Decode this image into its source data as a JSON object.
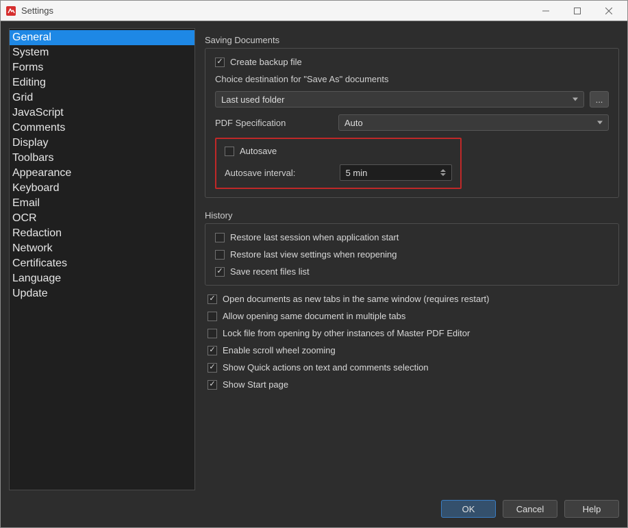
{
  "window": {
    "title": "Settings"
  },
  "sidebar": {
    "items": [
      "General",
      "System",
      "Forms",
      "Editing",
      "Grid",
      "JavaScript",
      "Comments",
      "Display",
      "Toolbars",
      "Appearance",
      "Keyboard",
      "Email",
      "OCR",
      "Redaction",
      "Network",
      "Certificates",
      "Language",
      "Update"
    ],
    "selected_index": 0
  },
  "saving": {
    "group_label": "Saving Documents",
    "create_backup": {
      "checked": true,
      "label": "Create backup file"
    },
    "save_as_dest_label": "Choice destination for \"Save As\" documents",
    "save_as_dest_value": "Last used folder",
    "browse_label": "...",
    "pdf_spec_label": "PDF Specification",
    "pdf_spec_value": "Auto",
    "autosave": {
      "checked": false,
      "label": "Autosave"
    },
    "autosave_interval_label": "Autosave interval:",
    "autosave_interval_value": "5 min"
  },
  "history": {
    "group_label": "History",
    "restore_session": {
      "checked": false,
      "label": "Restore last session when application start"
    },
    "restore_view": {
      "checked": false,
      "label": "Restore last view settings when reopening"
    },
    "save_recent": {
      "checked": true,
      "label": "Save recent files list"
    }
  },
  "options": {
    "open_as_tabs": {
      "checked": true,
      "label": "Open documents as new tabs in the same window (requires restart)"
    },
    "allow_multi": {
      "checked": false,
      "label": "Allow opening same document in multiple tabs"
    },
    "lock_file": {
      "checked": false,
      "label": "Lock file from opening by other instances of Master PDF Editor"
    },
    "scroll_zoom": {
      "checked": true,
      "label": "Enable scroll wheel zooming"
    },
    "quick_actions": {
      "checked": true,
      "label": "Show Quick actions on text and comments selection"
    },
    "start_page": {
      "checked": true,
      "label": "Show Start page"
    }
  },
  "footer": {
    "ok": "OK",
    "cancel": "Cancel",
    "help": "Help"
  }
}
